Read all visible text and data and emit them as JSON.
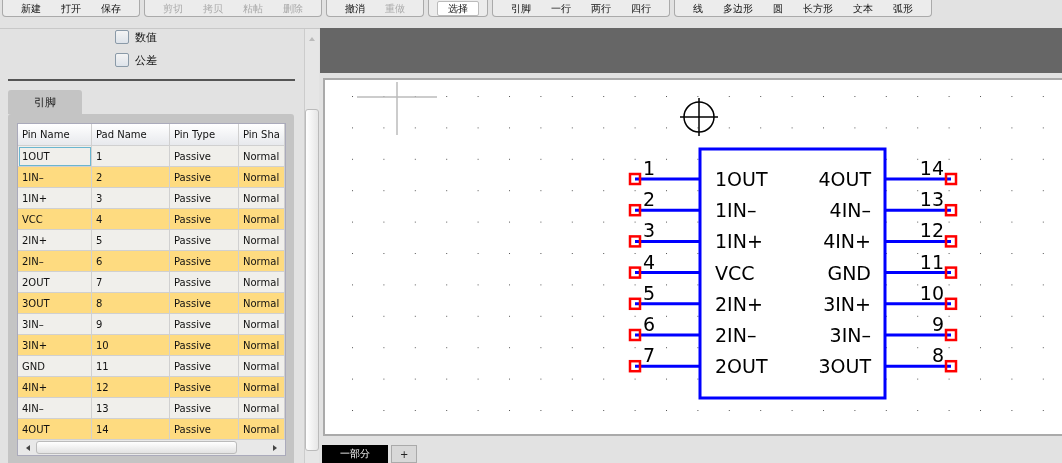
{
  "toolbar": [
    {
      "buttons": [
        {
          "label": "新建",
          "disabled": false,
          "selected": false
        },
        {
          "label": "打开",
          "disabled": false,
          "selected": false
        },
        {
          "label": "保存",
          "disabled": false,
          "selected": false
        }
      ]
    },
    {
      "buttons": [
        {
          "label": "剪切",
          "disabled": true,
          "selected": false
        },
        {
          "label": "拷贝",
          "disabled": true,
          "selected": false
        },
        {
          "label": "粘帖",
          "disabled": true,
          "selected": false
        },
        {
          "label": "删除",
          "disabled": true,
          "selected": false
        }
      ]
    },
    {
      "buttons": [
        {
          "label": "撤消",
          "disabled": false,
          "selected": false
        },
        {
          "label": "重做",
          "disabled": true,
          "selected": false
        }
      ]
    },
    {
      "buttons": [
        {
          "label": "选择",
          "disabled": false,
          "selected": true
        }
      ]
    },
    {
      "buttons": [
        {
          "label": "引脚",
          "disabled": false,
          "selected": false
        },
        {
          "label": "一行",
          "disabled": false,
          "selected": false
        },
        {
          "label": "两行",
          "disabled": false,
          "selected": false
        },
        {
          "label": "四行",
          "disabled": false,
          "selected": false
        }
      ]
    },
    {
      "buttons": [
        {
          "label": "线",
          "disabled": false,
          "selected": false
        },
        {
          "label": "多边形",
          "disabled": false,
          "selected": false
        },
        {
          "label": "圆",
          "disabled": false,
          "selected": false
        },
        {
          "label": "长方形",
          "disabled": false,
          "selected": false
        },
        {
          "label": "文本",
          "disabled": false,
          "selected": false
        },
        {
          "label": "弧形",
          "disabled": false,
          "selected": false
        }
      ]
    }
  ],
  "options": [
    {
      "label": "数值",
      "checked": false
    },
    {
      "label": "公差",
      "checked": false
    }
  ],
  "panel_tabs": [
    {
      "label": "引脚",
      "selected": true
    }
  ],
  "table": {
    "columns": [
      "Pin Name",
      "Pad Name",
      "Pin Type",
      "Pin Sha"
    ],
    "rows": [
      {
        "cells": [
          "1OUT",
          "1",
          "Passive",
          "Normal"
        ],
        "focused": true
      },
      {
        "cells": [
          "1IN–",
          "2",
          "Passive",
          "Normal"
        ],
        "focused": false
      },
      {
        "cells": [
          "1IN+",
          "3",
          "Passive",
          "Normal"
        ],
        "focused": false
      },
      {
        "cells": [
          "VCC",
          "4",
          "Passive",
          "Normal"
        ],
        "focused": false
      },
      {
        "cells": [
          "2IN+",
          "5",
          "Passive",
          "Normal"
        ],
        "focused": false
      },
      {
        "cells": [
          "2IN–",
          "6",
          "Passive",
          "Normal"
        ],
        "focused": false
      },
      {
        "cells": [
          "2OUT",
          "7",
          "Passive",
          "Normal"
        ],
        "focused": false
      },
      {
        "cells": [
          "3OUT",
          "8",
          "Passive",
          "Normal"
        ],
        "focused": false
      },
      {
        "cells": [
          "3IN–",
          "9",
          "Passive",
          "Normal"
        ],
        "focused": false
      },
      {
        "cells": [
          "3IN+",
          "10",
          "Passive",
          "Normal"
        ],
        "focused": false
      },
      {
        "cells": [
          "GND",
          "11",
          "Passive",
          "Normal"
        ],
        "focused": false
      },
      {
        "cells": [
          "4IN+",
          "12",
          "Passive",
          "Normal"
        ],
        "focused": false
      },
      {
        "cells": [
          "4IN–",
          "13",
          "Passive",
          "Normal"
        ],
        "focused": false
      },
      {
        "cells": [
          "4OUT",
          "14",
          "Passive",
          "Normal"
        ],
        "focused": false
      }
    ]
  },
  "symbol": {
    "left_pins": [
      {
        "number": "1",
        "name": "1OUT"
      },
      {
        "number": "2",
        "name": "1IN–"
      },
      {
        "number": "3",
        "name": "1IN+"
      },
      {
        "number": "4",
        "name": "VCC"
      },
      {
        "number": "5",
        "name": "2IN+"
      },
      {
        "number": "6",
        "name": "2IN–"
      },
      {
        "number": "7",
        "name": "2OUT"
      }
    ],
    "right_pins": [
      {
        "number": "14",
        "name": "4OUT"
      },
      {
        "number": "13",
        "name": "4IN–"
      },
      {
        "number": "12",
        "name": "4IN+"
      },
      {
        "number": "11",
        "name": "GND"
      },
      {
        "number": "10",
        "name": "3IN+"
      },
      {
        "number": "9",
        "name": "3IN–"
      },
      {
        "number": "8",
        "name": "3OUT"
      }
    ]
  },
  "sheet_tabs": [
    {
      "label": "一部分",
      "selected": true
    },
    {
      "label": "+",
      "selected": false
    }
  ]
}
